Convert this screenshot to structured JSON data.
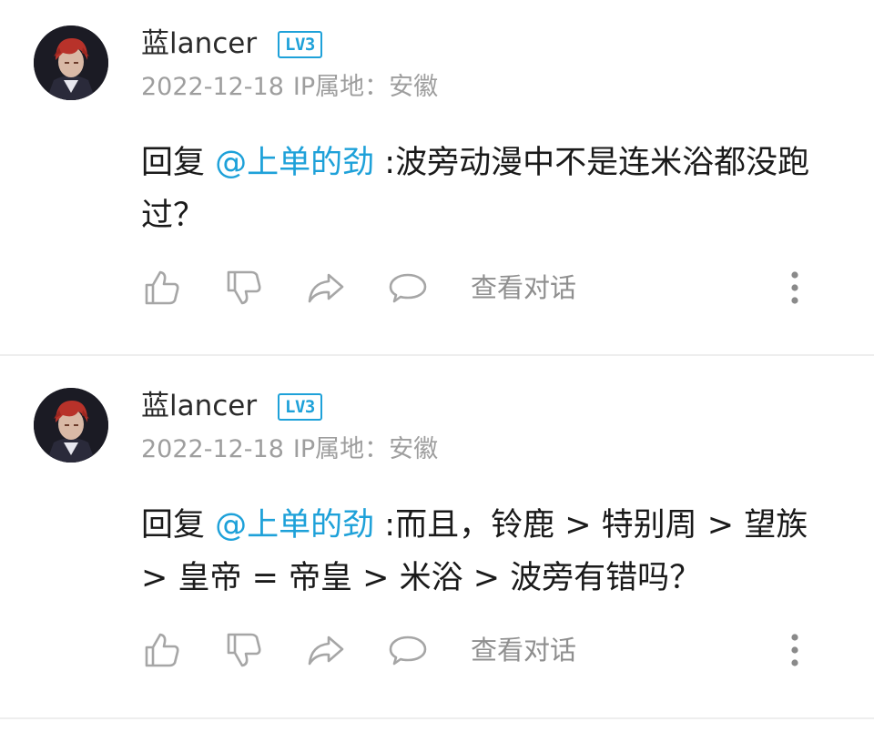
{
  "comments": [
    {
      "username": "蓝lancer",
      "level": "LV3",
      "date": "2022-12-18",
      "ip_location": "IP属地：安徽",
      "reply_prefix": "回复 ",
      "mention": "@上单的劲",
      "body": " :波旁动漫中不是连米浴都没跑过？",
      "view_conversation": "查看对话",
      "icons": [
        "thumbs-up-icon",
        "thumbs-down-icon",
        "share-icon",
        "comment-bubble-icon",
        "more-vertical-icon"
      ]
    },
    {
      "username": "蓝lancer",
      "level": "LV3",
      "date": "2022-12-18",
      "ip_location": "IP属地：安徽",
      "reply_prefix": "回复 ",
      "mention": "@上单的劲",
      "body": " :而且，铃鹿 > 特别周 > 望族 > 皇帝 = 帝皇 > 米浴 > 波旁有错吗？",
      "view_conversation": "查看对话",
      "icons": [
        "thumbs-up-icon",
        "thumbs-down-icon",
        "share-icon",
        "comment-bubble-icon",
        "more-vertical-icon"
      ]
    }
  ],
  "colors": {
    "accent": "#1ea1d9",
    "text": "#1a1a1a",
    "secondary": "#9e9e9e",
    "icon": "#a6a6a6",
    "divider": "#eeeeee"
  }
}
